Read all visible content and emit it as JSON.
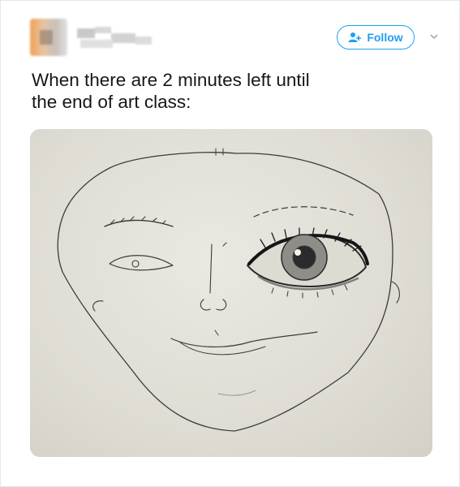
{
  "tweet": {
    "user": {
      "display_name": "",
      "handle": ""
    },
    "follow_label": "Follow",
    "text_lines": [
      "When there are 2 minutes left until",
      "the end of art class:"
    ]
  },
  "colors": {
    "accent": "#1da1f2",
    "text": "#14171a",
    "border": "#e1e8ed"
  },
  "icons": {
    "follow": "add-user-icon",
    "menu": "chevron-down-icon"
  },
  "media": {
    "kind": "photo",
    "subject": "pencil sketch of a face"
  }
}
